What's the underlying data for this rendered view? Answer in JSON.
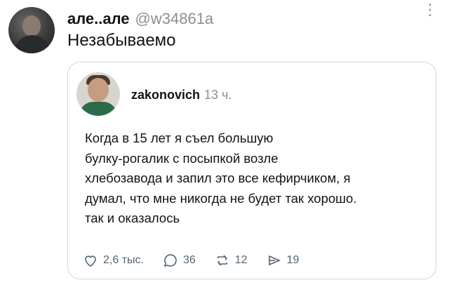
{
  "tweet": {
    "author_name": "але..але",
    "author_handle": "@w34861a",
    "text": "Незабываемо"
  },
  "quote": {
    "author_name": "zakonovich",
    "time": "13 ч.",
    "lines": [
      "Когда в 15 лет я съел большую",
      "булку-рогалик с посыпкой возле",
      "хлебозавода и запил это все кефирчиком, я",
      "думал, что мне никогда не будет так хорошо.",
      "так и оказалось"
    ],
    "actions": {
      "likes": "2,6 тыс.",
      "replies": "36",
      "reposts": "12",
      "shares": "19"
    }
  },
  "icons": {
    "more": "more-vertical-icon",
    "like": "heart-icon",
    "reply": "comment-bubble-icon",
    "repost": "repost-icon",
    "share": "share-arrow-icon"
  }
}
